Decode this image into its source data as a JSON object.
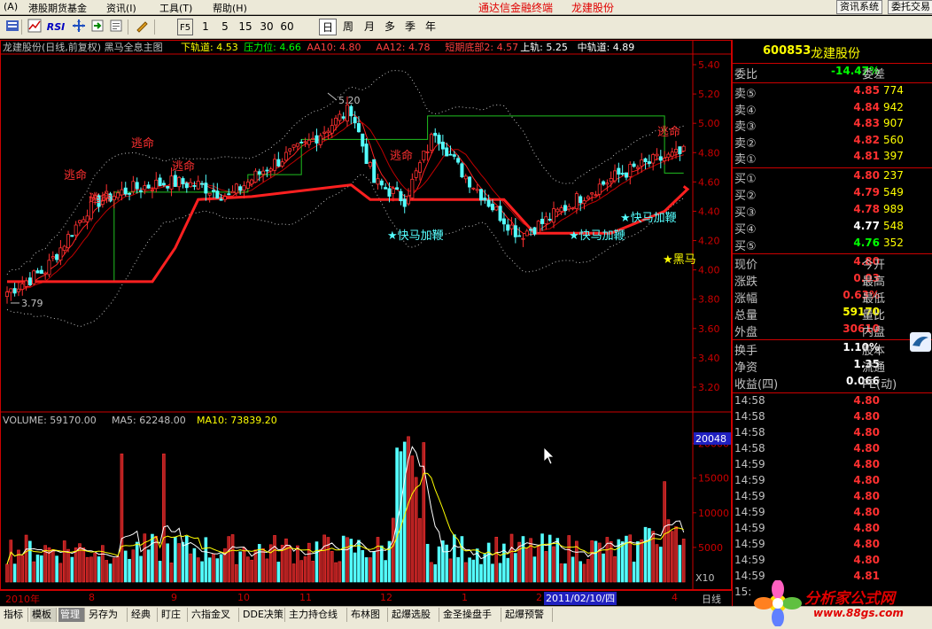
{
  "menu": {
    "items": [
      "(A)",
      "港股期货基金",
      "资讯(I)",
      "工具(T)",
      "帮助(H)"
    ],
    "title": "通达信金融终端",
    "stock_name": "龙建股份",
    "right_buttons": [
      "资讯系统",
      "委托交易"
    ]
  },
  "toolbar": {
    "icons": [
      "fs-icon",
      "rsi-icon",
      "cross-icon",
      "login-icon",
      "info-icon",
      "draw-icon"
    ],
    "rsi_label": "RSI",
    "f5_label": "F5",
    "periods": [
      "1",
      "5",
      "15",
      "30",
      "60",
      "日",
      "周",
      "月",
      "多",
      "季",
      "年"
    ],
    "selected_period": "日"
  },
  "chart_header": {
    "title": "龙建股份(日线,前复权) 黑马全息主图",
    "indicators": [
      {
        "label": "下轨道: 4.53",
        "color": "#ffff00"
      },
      {
        "label": "压力位: 4.66",
        "color": "#00ff00"
      },
      {
        "label": "AA10: 4.80",
        "color": "#ff4040"
      },
      {
        "label": "AA12: 4.78",
        "color": "#ff4040"
      },
      {
        "label": "短期底部2: 4.57",
        "color": "#ff4040"
      },
      {
        "label": "上轨: 5.25",
        "color": "#ffffff"
      },
      {
        "label": "中轨道: 4.89",
        "color": "#ffffff"
      }
    ]
  },
  "volume_header": {
    "volume": "VOLUME: 59170.00",
    "ma5": "MA5: 62248.00",
    "ma10": "MA10: 73839.20"
  },
  "price_axis": [
    "5.40",
    "5.20",
    "5.00",
    "4.80",
    "4.60",
    "4.40",
    "4.20",
    "4.00",
    "3.80",
    "3.60",
    "3.40",
    "3.20"
  ],
  "volume_axis": [
    "20000",
    "15000",
    "10000",
    "5000"
  ],
  "volume_cursor": "20048",
  "volume_unit": "X10",
  "annotations": {
    "escape": "逃命",
    "fast_horse": "★快马加鞭",
    "black_horse": "★黑马",
    "high_label": "5.20",
    "low_label": "3.79"
  },
  "dates": {
    "labels": [
      "2010年",
      "8",
      "9",
      "10",
      "11",
      "12",
      "1",
      "2",
      "4"
    ],
    "cursor": "2011/02/10/四",
    "period": "日线"
  },
  "quote": {
    "code": "600853",
    "name": "龙建股份",
    "wei_bi_label": "委比",
    "wei_bi_value": "-14.47%",
    "wei_cha_label": "委差",
    "asks": [
      {
        "label": "卖⑤",
        "price": "4.85",
        "vol": "774"
      },
      {
        "label": "卖④",
        "price": "4.84",
        "vol": "942"
      },
      {
        "label": "卖③",
        "price": "4.83",
        "vol": "907"
      },
      {
        "label": "卖②",
        "price": "4.82",
        "vol": "560"
      },
      {
        "label": "卖①",
        "price": "4.81",
        "vol": "397"
      }
    ],
    "bids": [
      {
        "label": "买①",
        "price": "4.80",
        "vol": "237",
        "color": "#ff3030"
      },
      {
        "label": "买②",
        "price": "4.79",
        "vol": "549",
        "color": "#ff3030"
      },
      {
        "label": "买③",
        "price": "4.78",
        "vol": "989",
        "color": "#ff3030"
      },
      {
        "label": "买④",
        "price": "4.77",
        "vol": "548",
        "color": "#ffffff"
      },
      {
        "label": "买⑤",
        "price": "4.76",
        "vol": "352",
        "color": "#00ff00"
      }
    ],
    "stats": [
      {
        "l1": "现价",
        "v": "4.80",
        "l2": "今开",
        "color": "#ff3030"
      },
      {
        "l1": "涨跌",
        "v": "0.03",
        "l2": "最高",
        "color": "#ff3030"
      },
      {
        "l1": "涨幅",
        "v": "0.63%",
        "l2": "最低",
        "color": "#ff3030"
      },
      {
        "l1": "总量",
        "v": "59170",
        "l2": "量比",
        "color": "#ffff00"
      },
      {
        "l1": "外盘",
        "v": "30610",
        "l2": "内盘",
        "color": "#ff3030"
      }
    ],
    "stats2": [
      {
        "l1": "换手",
        "v": "1.10%",
        "l2": "股本",
        "color": "#ffffff"
      },
      {
        "l1": "净资",
        "v": "1.35",
        "l2": "流通",
        "color": "#ffffff"
      },
      {
        "l1": "收益(四)",
        "v": "0.066",
        "l2": "PE(动)",
        "color": "#ffffff"
      }
    ],
    "ticks": [
      {
        "time": "14:58",
        "price": "4.80"
      },
      {
        "time": "14:58",
        "price": "4.80"
      },
      {
        "time": "14:58",
        "price": "4.80"
      },
      {
        "time": "14:58",
        "price": "4.80"
      },
      {
        "time": "14:59",
        "price": "4.80"
      },
      {
        "time": "14:59",
        "price": "4.80"
      },
      {
        "time": "14:59",
        "price": "4.80"
      },
      {
        "time": "14:59",
        "price": "4.80"
      },
      {
        "time": "14:59",
        "price": "4.80"
      },
      {
        "time": "14:59",
        "price": "4.80"
      },
      {
        "time": "14:59",
        "price": "4.80"
      },
      {
        "time": "14:59",
        "price": "4.81"
      },
      {
        "time": "15:",
        "price": ""
      }
    ]
  },
  "tabs": [
    "指标",
    "模板",
    "管理",
    "另存为",
    "经典",
    "盯庄",
    "六指金叉",
    "DDE决策",
    "主力持仓线",
    "布林图",
    "起爆选股",
    "金圣操盘手",
    "起爆预警"
  ],
  "active_tab": "管理",
  "logo": {
    "text": "分析家公式网",
    "url": "www.88gs.com"
  },
  "colors": {
    "up": "#ff3030",
    "down": "#54ffff",
    "bg": "#000000",
    "grid_red": "#c00000"
  }
}
